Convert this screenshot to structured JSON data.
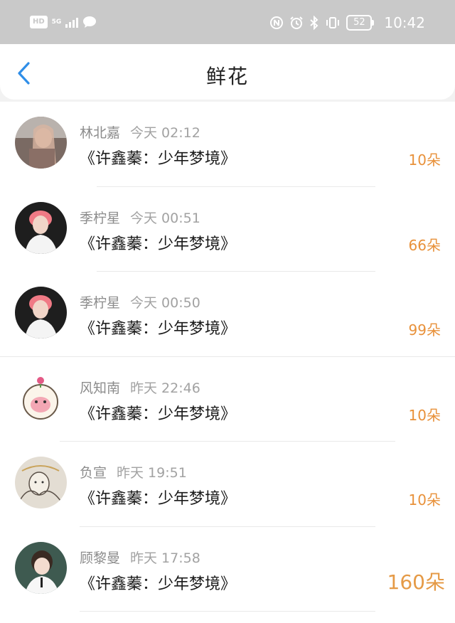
{
  "status_bar": {
    "hd": "HD",
    "network": "5G",
    "battery": "52",
    "time": "10:42",
    "icons": [
      "hd-icon",
      "signal-icon",
      "message-icon",
      "nfc-icon",
      "alarm-icon",
      "bluetooth-icon",
      "vibrate-icon",
      "battery-icon"
    ]
  },
  "header": {
    "title": "鲜花",
    "back_icon": "chevron-left-icon",
    "accent": "#2f8ee8"
  },
  "items": [
    {
      "name": "林北嘉",
      "time": "今天 02:12",
      "work": "《许鑫蓁：少年梦境》",
      "count": "10朵"
    },
    {
      "name": "季柠星",
      "time": "今天 00:51",
      "work": "《许鑫蓁：少年梦境》",
      "count": "66朵"
    },
    {
      "name": "季柠星",
      "time": "今天 00:50",
      "work": "《许鑫蓁：少年梦境》",
      "count": "99朵"
    },
    {
      "name": "风知南",
      "time": "昨天 22:46",
      "work": "《许鑫蓁：少年梦境》",
      "count": "10朵"
    },
    {
      "name": "负宣",
      "time": "昨天 19:51",
      "work": "《许鑫蓁：少年梦境》",
      "count": "10朵"
    },
    {
      "name": "顾黎曼",
      "time": "昨天 17:58",
      "work": "《许鑫蓁：少年梦境》",
      "count": "160朵"
    }
  ],
  "colors": {
    "count": "#e8913a",
    "status_bar": "#c9c9c9"
  }
}
